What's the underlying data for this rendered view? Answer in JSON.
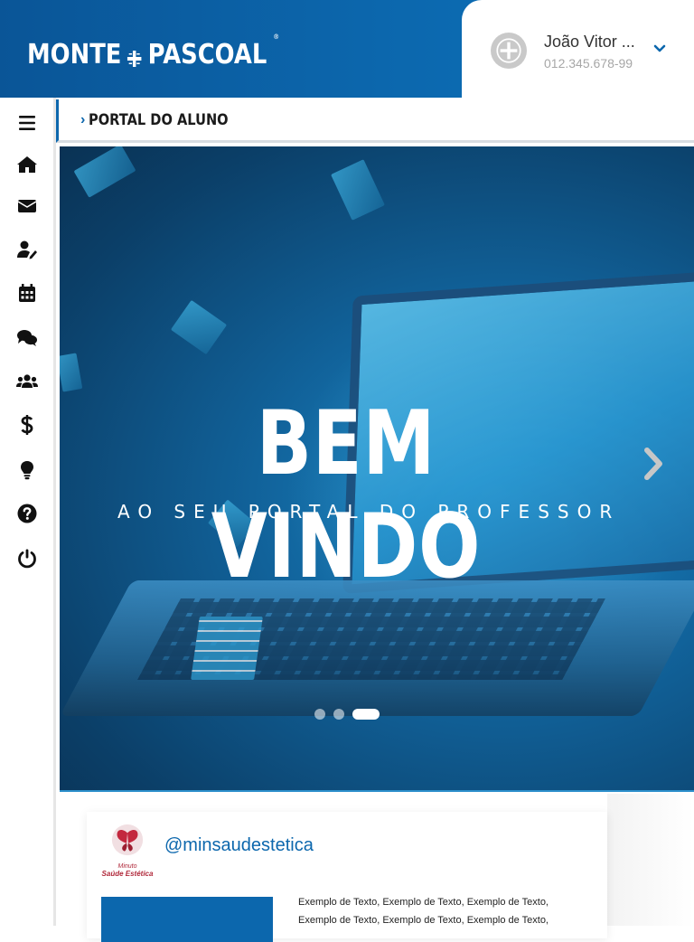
{
  "brand": {
    "logo_left": "MONTE",
    "logo_right": "PASCOAL",
    "registered": "®"
  },
  "user": {
    "name": "João Vitor ...",
    "cpf": "012.345.678-99"
  },
  "breadcrumb": {
    "arrow": "›",
    "label": "PORTAL DO ALUNO"
  },
  "sidebar": {
    "items": [
      {
        "id": "menu",
        "icon": "menu-icon"
      },
      {
        "id": "home",
        "icon": "home-icon"
      },
      {
        "id": "messages",
        "icon": "envelope-icon"
      },
      {
        "id": "profile-edit",
        "icon": "user-edit-icon"
      },
      {
        "id": "calendar",
        "icon": "calendar-icon"
      },
      {
        "id": "chat",
        "icon": "chat-icon"
      },
      {
        "id": "groups",
        "icon": "users-icon"
      },
      {
        "id": "finance",
        "icon": "dollar-icon"
      },
      {
        "id": "ideas",
        "icon": "lightbulb-icon"
      },
      {
        "id": "help",
        "icon": "question-icon"
      },
      {
        "id": "logout",
        "icon": "power-icon"
      }
    ]
  },
  "hero": {
    "title": "BEM VINDO",
    "subtitle": "AO SEU PORTAL DO PROFESSOR",
    "slides_total": 3,
    "active_slide": 3
  },
  "feed": {
    "logo_line1": "Minuto",
    "logo_line2": "Saúde Estética",
    "handle": "@minsaudestetica",
    "text": "Exemplo de Texto, Exemplo de Texto, Exemplo de Texto, Exemplo de Texto, Exemplo de Texto, Exemplo de Texto,"
  },
  "colors": {
    "primary": "#0c67ad",
    "header_dark": "#0a5597",
    "muted": "#a7a7a7"
  }
}
